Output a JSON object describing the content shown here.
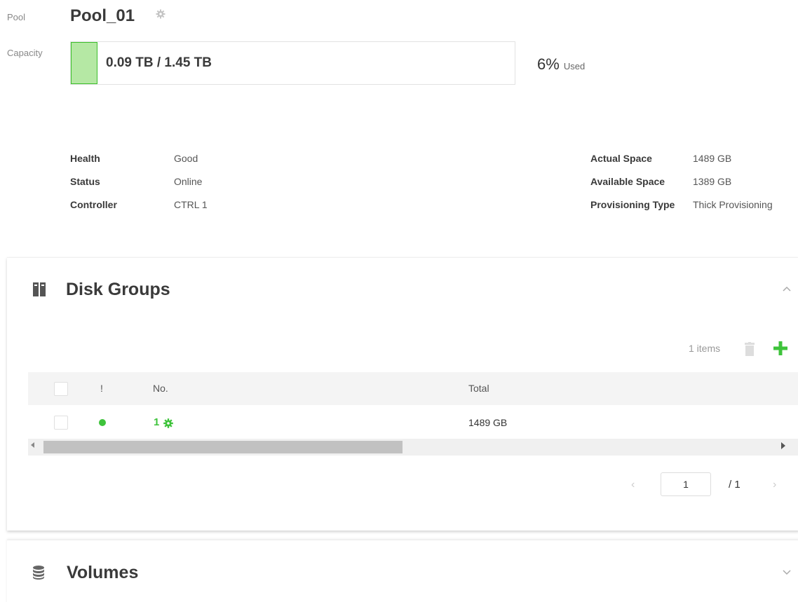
{
  "pool": {
    "label": "Pool",
    "name": "Pool_01",
    "capacity_label": "Capacity",
    "capacity_text": "0.09 TB / 1.45 TB",
    "used_fraction": 0.06,
    "used_percent": "6%",
    "used_word": "Used"
  },
  "info_left": [
    {
      "label": "Health",
      "value": "Good"
    },
    {
      "label": "Status",
      "value": "Online"
    },
    {
      "label": "Controller",
      "value": "CTRL 1"
    }
  ],
  "info_right": [
    {
      "label": "Actual Space",
      "value": "1489 GB"
    },
    {
      "label": "Available Space",
      "value": "1389 GB"
    },
    {
      "label": "Provisioning Type",
      "value": "Thick Provisioning"
    }
  ],
  "disk_groups": {
    "title": "Disk Groups",
    "items_count": "1 items",
    "columns": {
      "alert": "!",
      "no": "No.",
      "total": "Total"
    },
    "rows": [
      {
        "no": "1",
        "total": "1489 GB",
        "health_color": "#3ec33b"
      }
    ],
    "pager": {
      "current": "1",
      "total": "/ 1"
    }
  },
  "volumes": {
    "title": "Volumes"
  },
  "colors": {
    "accent_green": "#3ec33b",
    "capacity_fill": "#b5e8a4"
  },
  "icons": [
    "gear-icon",
    "disk-groups-icon",
    "database-icon",
    "trash-icon",
    "plus-icon",
    "chevron-up-icon",
    "chevron-down-icon"
  ]
}
